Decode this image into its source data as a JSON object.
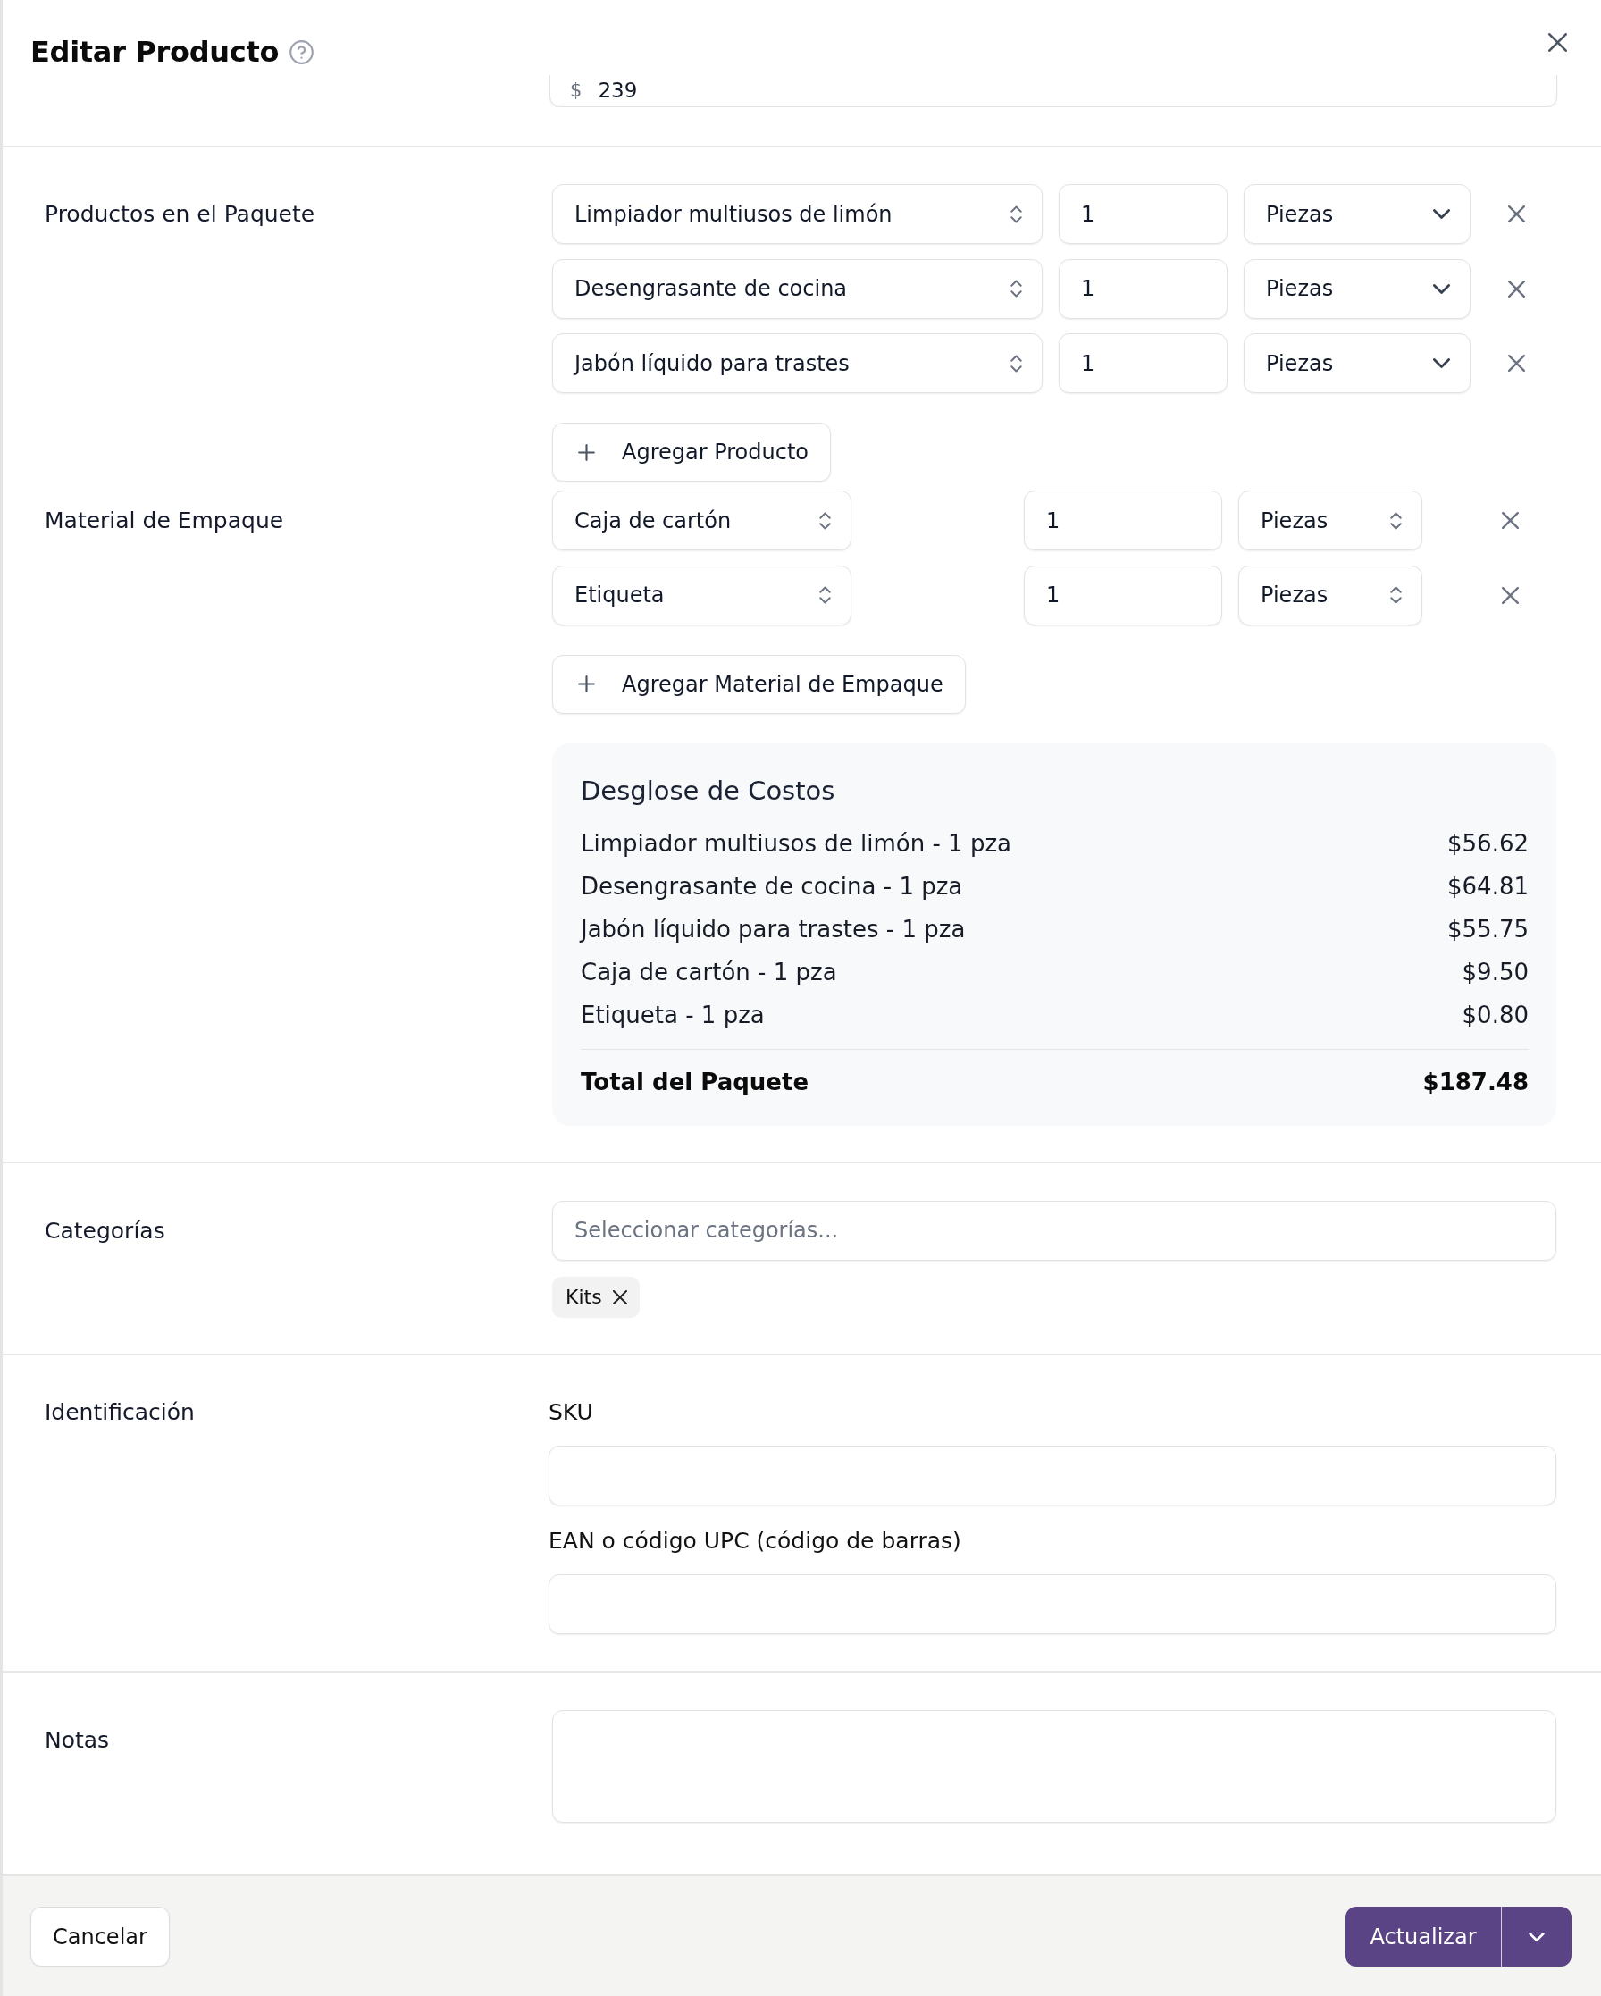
{
  "header": {
    "title": "Editar Producto"
  },
  "price_field": {
    "prefix": "$",
    "value": "239"
  },
  "package_products": {
    "label": "Productos en el Paquete",
    "rows": [
      {
        "product": "Limpiador multiusos de limón",
        "quantity": "1",
        "unit": "Piezas"
      },
      {
        "product": "Desengrasante de cocina",
        "quantity": "1",
        "unit": "Piezas"
      },
      {
        "product": "Jabón líquido para trastes",
        "quantity": "1",
        "unit": "Piezas"
      }
    ],
    "add_button": "Agregar Producto"
  },
  "packaging_materials": {
    "label": "Material de Empaque",
    "rows": [
      {
        "material": "Caja de cartón",
        "quantity": "1",
        "unit": "Piezas"
      },
      {
        "material": "Etiqueta",
        "quantity": "1",
        "unit": "Piezas"
      }
    ],
    "add_button": "Agregar Material de Empaque"
  },
  "cost_breakdown": {
    "title": "Desglose de Costos",
    "lines": [
      {
        "label": "Limpiador multiusos de limón - 1 pza",
        "amount": "$56.62"
      },
      {
        "label": "Desengrasante de cocina - 1 pza",
        "amount": "$64.81"
      },
      {
        "label": "Jabón líquido para trastes - 1 pza",
        "amount": "$55.75"
      },
      {
        "label": "Caja de cartón - 1 pza",
        "amount": "$9.50"
      },
      {
        "label": "Etiqueta - 1 pza",
        "amount": "$0.80"
      }
    ],
    "total": {
      "label": "Total del Paquete",
      "amount": "$187.48"
    }
  },
  "categories": {
    "label": "Categorías",
    "placeholder": "Seleccionar categorías...",
    "tags": [
      "Kits"
    ]
  },
  "identification": {
    "label": "Identificación",
    "fields": [
      {
        "label": "SKU"
      },
      {
        "label": "EAN o código UPC (código de barras)"
      }
    ]
  },
  "notes": {
    "label": "Notas"
  },
  "footer": {
    "cancel_button": "Cancelar",
    "submit_button": "Actualizar"
  }
}
